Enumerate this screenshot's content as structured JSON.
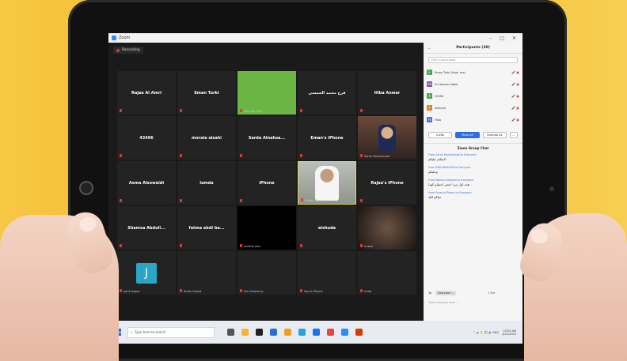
{
  "window": {
    "title": "Zoom",
    "ctrl_min": "–",
    "ctrl_max": "□",
    "ctrl_close": "✕"
  },
  "recording": {
    "label": "Recording"
  },
  "tiles": [
    {
      "label": "Rajaa Al Amri",
      "style": "plain"
    },
    {
      "label": "Eman Turki",
      "style": "plain"
    },
    {
      "label": "",
      "style": "green",
      "caption": "Zain Ibn Eeh..."
    },
    {
      "label": "قرح محمد الحمسي",
      "style": "plain"
    },
    {
      "label": "Hiba Anwar",
      "style": "plain"
    },
    {
      "label": "43496",
      "style": "plain"
    },
    {
      "label": "moraie alzahi",
      "style": "plain"
    },
    {
      "label": "Sarda Alnahsa...",
      "style": "plain"
    },
    {
      "label": "Eman's iPhone",
      "style": "plain"
    },
    {
      "label": "",
      "style": "photo",
      "caption": "Sarah Mohammad"
    },
    {
      "label": "Asma Alsowaidi",
      "style": "plain"
    },
    {
      "label": "lamda",
      "style": "plain"
    },
    {
      "label": "iPhone",
      "style": "plain"
    },
    {
      "label": "",
      "style": "speaker",
      "caption": "Sheikh Ahmad"
    },
    {
      "label": "Rajaa's iPhone",
      "style": "plain"
    },
    {
      "label": "Shamsa Abdull...",
      "style": "plain"
    },
    {
      "label": "fatma abdi ba...",
      "style": "plain"
    },
    {
      "label": "",
      "style": "blackcard",
      "caption": "shubab jhan"
    },
    {
      "label": "alshuda",
      "style": "plain"
    },
    {
      "label": "",
      "style": "warm",
      "caption": "Anwar"
    },
    {
      "label": "J",
      "style": "avatar",
      "caption": "Jamil Hagar"
    },
    {
      "label": "",
      "style": "plain",
      "caption": "Rubia Hamid"
    },
    {
      "label": "",
      "style": "plain",
      "caption": "Fair Alhashmy"
    },
    {
      "label": "",
      "style": "plain",
      "caption": "Sara's iPhone"
    },
    {
      "label": "",
      "style": "plain",
      "caption": "Huda"
    }
  ],
  "participants": {
    "title": "Participants (30)",
    "collapse": "⌄",
    "search_placeholder": "Find a participant",
    "list": [
      {
        "initial": "E",
        "color": "#45a34a",
        "name": "Eman Turki (Host, me)",
        "icons": "🎤 ▣"
      },
      {
        "initial": "AA",
        "color": "#8a4fb8",
        "name": "Dr Hassan Habib",
        "icons": "🎤 ▣"
      },
      {
        "initial": "4",
        "color": "#45a34a",
        "name": "43496",
        "icons": "🎤 ▣"
      },
      {
        "initial": "A",
        "color": "#e07b21",
        "name": "alshuda",
        "icons": "🎤 ▣"
      },
      {
        "initial": "H",
        "color": "#3a7bd5",
        "name": "Hiba",
        "icons": "🎤 ▣"
      }
    ],
    "btn_invite": "Invite",
    "btn_mute_all": "Mute All",
    "btn_unmute_all": "Unmute All",
    "btn_more": "..."
  },
  "chat": {
    "title": "Zoom Group Chat",
    "messages": [
      {
        "from": "From Sarah Mohammad to Everyone:",
        "text": "السلام عليكم"
      },
      {
        "from": "From IMAN NASSER to Everyone:",
        "text": "وعليكم"
      },
      {
        "from": "From Mariam Alsayed to Everyone:",
        "text": "هذه اول مرة احضر اجتماع كهذا"
      },
      {
        "from": "From Eman's iPhone to Everyone:",
        "text": "حياكم الله"
      }
    ],
    "to_label": "To:",
    "to_value": "Everyone ⌄",
    "file_label": "▯ File",
    "input_placeholder": "Type message here ..."
  },
  "taskbar": {
    "search_placeholder": "Type here to search",
    "time": "10:54 AM",
    "date": "4/21/2020",
    "tray_icons": "^ ☁ 🔋 📶 🔊 ENG"
  }
}
